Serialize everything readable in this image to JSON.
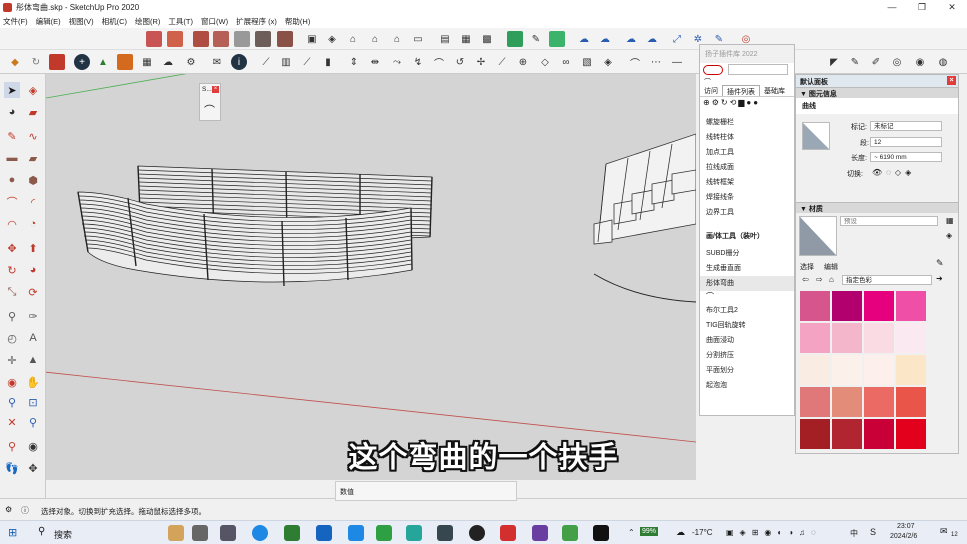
{
  "window": {
    "title": "彤体弯曲.skp - SketchUp Pro 2020",
    "controls": [
      "—",
      "❐",
      "✕"
    ]
  },
  "menu": [
    "文件(F)",
    "编辑(E)",
    "视图(V)",
    "相机(C)",
    "绘图(R)",
    "工具(T)",
    "窗口(W)",
    "扩展程序 (x)",
    "帮助(H)"
  ],
  "mini_toolbar": {
    "title": "S...",
    "close": "×"
  },
  "plugin_panel": {
    "header": "扬子插件库 2022",
    "tabs": [
      "访问",
      "插件列表",
      "基础库"
    ],
    "items_top": [
      "螺旋栅栏",
      "线转柱体",
      "加点工具",
      "拉线成面",
      "线转框架",
      "焊接线条",
      "边界工具"
    ],
    "section_heading": "画/体工具（装叶）",
    "items_mid": [
      "SUBD栅分",
      "生成垂直面",
      "彤体弯曲"
    ],
    "highlighted_item": "彤体弯曲",
    "items_bottom": [
      "布尔工具2",
      "TIG回轨旋转",
      "曲面浸动",
      "分割挤压",
      "平面划分",
      "起泡泡"
    ]
  },
  "tray": {
    "title": "默认面板",
    "entity_info": {
      "section": "图元信息",
      "entity": "曲线",
      "tag_label": "标记:",
      "tag_value": "未标记",
      "segments_label": "段:",
      "segments_value": "12",
      "length_label": "长度:",
      "length_value": "~ 6190 mm",
      "toggle_label": "切换:"
    },
    "materials": {
      "section": "材质",
      "preview_name": "预设",
      "tabs": [
        "选择",
        "编辑"
      ],
      "dropdown": "指定色彩",
      "swatch_colors": [
        "#d6558c",
        "#b3006f",
        "#e6007e",
        "#ef4fa6",
        "#f5a3c2",
        "#f4b6cb",
        "#fbdbe3",
        "#fbe9f1",
        "#f8ece3",
        "#fbf1ea",
        "#fdf0ec",
        "#fce6c8",
        "#e07879",
        "#e48c7a",
        "#ec6a64",
        "#ea5549",
        "#a41f24",
        "#b0252f",
        "#c90037",
        "#e2001d"
      ]
    }
  },
  "measurements": {
    "label": "数值"
  },
  "status": {
    "text": "选择对象。切换到扩充选择。拖动鼠标选择多项。"
  },
  "subtitle": "这个弯曲的一个扶手",
  "taskbar": {
    "search": "搜索",
    "battery": "99%",
    "weather": "-17°C",
    "lang": "中",
    "time": "23:07",
    "date": "2024/2/6",
    "notifications": "12"
  }
}
